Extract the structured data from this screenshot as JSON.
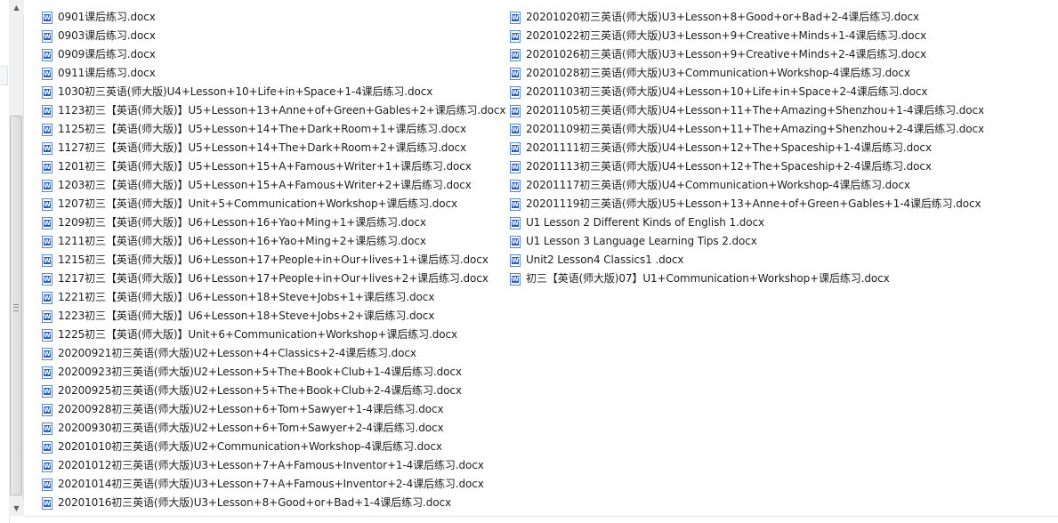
{
  "colors": {
    "icon_blue": "#2b5fb4",
    "scrollbar_bg": "#f0f0f0",
    "text": "#1e1e1e"
  },
  "scrollbar": {
    "up_arrow_icon": "chevron-up-icon",
    "down_arrow_icon": "chevron-down-icon"
  },
  "file_icon": "word-document-icon",
  "files_left": [
    "0901课后练习.docx",
    "0903课后练习.docx",
    "0909课后练习.docx",
    "0911课后练习.docx",
    "1030初三英语(师大版)U4+Lesson+10+Life+in+Space+1-4课后练习.docx",
    "1123初三【英语(师大版)】U5+Lesson+13+Anne+of+Green+Gables+2+课后练习.docx",
    "1125初三【英语(师大版)】U5+Lesson+14+The+Dark+Room+1+课后练习.docx",
    "1127初三【英语(师大版)】U5+Lesson+14+The+Dark+Room+2+课后练习.docx",
    "1201初三【英语(师大版)】U5+Lesson+15+A+Famous+Writer+1+课后练习.docx",
    "1203初三【英语(师大版)】U5+Lesson+15+A+Famous+Writer+2+课后练习.docx",
    "1207初三【英语(师大版)】Unit+5+Communication+Workshop+课后练习.docx",
    "1209初三【英语(师大版)】U6+Lesson+16+Yao+Ming+1+课后练习.docx",
    "1211初三【英语(师大版)】U6+Lesson+16+Yao+Ming+2+课后练习.docx",
    "1215初三【英语(师大版)】U6+Lesson+17+People+in+Our+lives+1+课后练习.docx",
    "1217初三【英语(师大版)】U6+Lesson+17+People+in+Our+lives+2+课后练习.docx",
    "1221初三【英语(师大版)】U6+Lesson+18+Steve+Jobs+1+课后练习.docx",
    "1223初三【英语(师大版)】U6+Lesson+18+Steve+Jobs+2+课后练习.docx",
    "1225初三【英语(师大版)】Unit+6+Communication+Workshop+课后练习.docx",
    "20200921初三英语(师大版)U2+Lesson+4+Classics+2-4课后练习.docx",
    "20200923初三英语(师大版)U2+Lesson+5+The+Book+Club+1-4课后练习.docx",
    "20200925初三英语(师大版)U2+Lesson+5+The+Book+Club+2-4课后练习.docx",
    "20200928初三英语(师大版)U2+Lesson+6+Tom+Sawyer+1-4课后练习.docx",
    "20200930初三英语(师大版)U2+Lesson+6+Tom+Sawyer+2-4课后练习.docx",
    "20201010初三英语(师大版)U2+Communication+Workshop-4课后练习.docx",
    "20201012初三英语(师大版)U3+Lesson+7+A+Famous+Inventor+1-4课后练习.docx",
    "20201014初三英语(师大版)U3+Lesson+7+A+Famous+Inventor+2-4课后练习.docx",
    "20201016初三英语(师大版)U3+Lesson+8+Good+or+Bad+1-4课后练习.docx"
  ],
  "files_right": [
    "20201020初三英语(师大版)U3+Lesson+8+Good+or+Bad+2-4课后练习.docx",
    "20201022初三英语(师大版)U3+Lesson+9+Creative+Minds+1-4课后练习.docx",
    "20201026初三英语(师大版)U3+Lesson+9+Creative+Minds+2-4课后练习.docx",
    "20201028初三英语(师大版)U3+Communication+Workshop-4课后练习.docx",
    "20201103初三英语(师大版)U4+Lesson+10+Life+in+Space+2-4课后练习.docx",
    "20201105初三英语(师大版)U4+Lesson+11+The+Amazing+Shenzhou+1-4课后练习.docx",
    "20201109初三英语(师大版)U4+Lesson+11+The+Amazing+Shenzhou+2-4课后练习.docx",
    "20201111初三英语(师大版)U4+Lesson+12+The+Spaceship+1-4课后练习.docx",
    "20201113初三英语(师大版)U4+Lesson+12+The+Spaceship+2-4课后练习.docx",
    "20201117初三英语(师大版)U4+Communication+Workshop-4课后练习.docx",
    "20201119初三英语(师大版)U5+Lesson+13+Anne+of+Green+Gables+1-4课后练习.docx",
    "U1 Lesson 2 Different Kinds of English 1.docx",
    "U1 Lesson 3 Language Learning Tips 2.docx",
    "Unit2 Lesson4 Classics1 .docx",
    "初三【英语(师大版)07】U1+Communication+Workshop+课后练习.docx"
  ]
}
